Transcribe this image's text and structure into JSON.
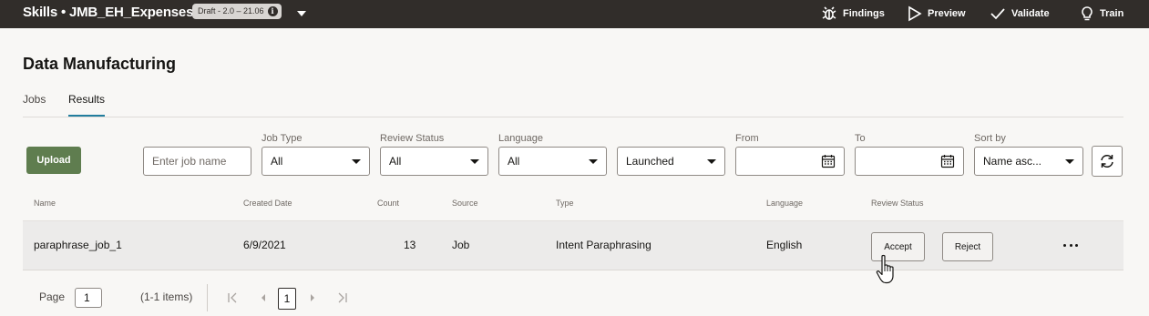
{
  "topbar": {
    "title": "Skills • JMB_EH_Expenses",
    "badge": "Draft - 2.0 – 21.06",
    "actions": {
      "findings": "Findings",
      "preview": "Preview",
      "validate": "Validate",
      "train": "Train"
    }
  },
  "page": {
    "title": "Data Manufacturing",
    "tabs": [
      "Jobs",
      "Results"
    ],
    "active_tab": "Results"
  },
  "filters": {
    "upload_label": "Upload",
    "job_name": {
      "value": "",
      "placeholder": "Enter job name"
    },
    "job_type": {
      "label": "Job Type",
      "value": "All"
    },
    "review_status": {
      "label": "Review Status",
      "value": "All"
    },
    "language": {
      "label": "Language",
      "value": "All"
    },
    "launch_state": {
      "value": "Launched"
    },
    "from": {
      "label": "From",
      "value": ""
    },
    "to": {
      "label": "To",
      "value": ""
    },
    "sort_by": {
      "label": "Sort by",
      "value": "Name asc..."
    }
  },
  "table": {
    "columns": [
      "Name",
      "Created Date",
      "Count",
      "Source",
      "Type",
      "Language",
      "Review Status"
    ],
    "rows": [
      {
        "name": "paraphrase_job_1",
        "created_date": "6/9/2021",
        "count": "13",
        "source": "Job",
        "type": "Intent Paraphrasing",
        "language": "English",
        "accept_label": "Accept",
        "reject_label": "Reject"
      }
    ]
  },
  "pagination": {
    "page_label": "Page",
    "page_value": "1",
    "summary": "(1-1 items)",
    "current_page": "1"
  },
  "colors": {
    "topbar": "#312d2a",
    "upload_button": "#5f7d4f",
    "active_tab_underline": "#227e9e",
    "row_background": "#ecebea"
  },
  "icons": [
    "findings-bug-icon",
    "preview-play-icon",
    "validate-check-icon",
    "train-lightbulb-icon",
    "info-icon",
    "chevron-down-icon",
    "calendar-icon",
    "refresh-icon",
    "more-options-icon",
    "first-page-icon",
    "previous-page-icon",
    "next-page-icon",
    "last-page-icon",
    "hand-pointer-cursor-icon"
  ]
}
